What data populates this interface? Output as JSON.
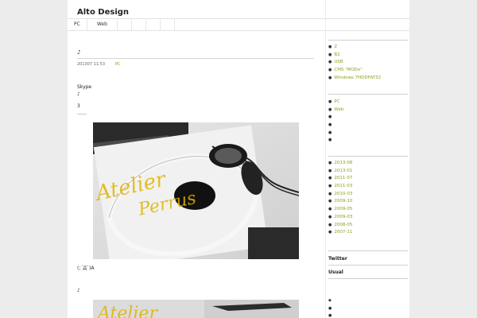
{
  "site": {
    "title": "Alto Design"
  },
  "nav": {
    "items": [
      "PC",
      "Web"
    ]
  },
  "post": {
    "mark": "♪",
    "date": "201307 11:53",
    "category": "PC",
    "p1": "Skype",
    "p2": "♪",
    "p3": "3",
    "p4": "……",
    "caption": "(;´Д`)A",
    "mark2": "♪"
  },
  "photo": {
    "watermark1": "Atelier",
    "watermark2": "Perrus"
  },
  "sidebar": {
    "recent": [
      "Z",
      "B2",
      "USB",
      "CMS \"MODx\"",
      "Windows 7HDDFAT32"
    ],
    "categories": [
      "PC",
      "Web",
      "",
      "",
      "",
      ""
    ],
    "archives": [
      "2013-08",
      "2013-01",
      "2011-07",
      "2011-03",
      "2010-03",
      "2009-10",
      "2009-05",
      "2009-03",
      "2008-05",
      "2007-11"
    ],
    "twitter_heading": "Twitter",
    "usual_heading": "Usual",
    "bottom_items": [
      "",
      "",
      ""
    ]
  },
  "colors": {
    "link": "#8aa31c",
    "text": "#333333",
    "background": "#ececec",
    "page": "#ffffff"
  }
}
